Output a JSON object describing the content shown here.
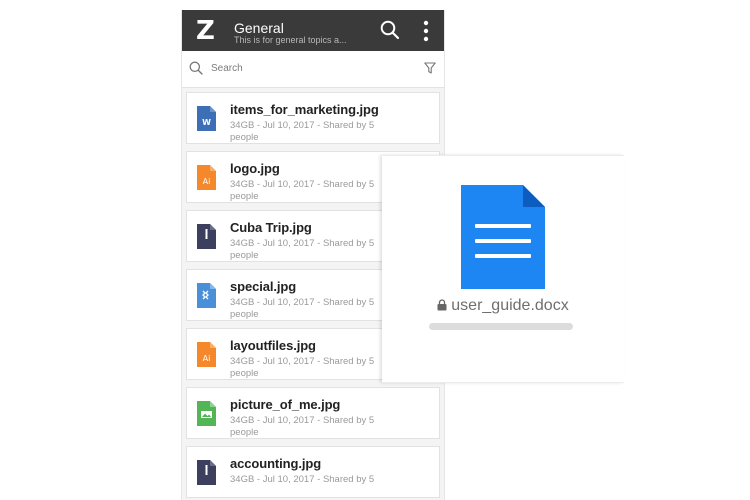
{
  "app": {
    "logo_letter": "Z",
    "title": "General",
    "subtitle": "This is for general topics a..."
  },
  "search": {
    "placeholder": "Search"
  },
  "files": [
    {
      "name": "items_for_marketing.jpg",
      "meta": "34GB -  Jul 10, 2017  - Shared by 5 people",
      "icon": "word-doc-icon",
      "color": "#3d6fb6",
      "glyph": "W"
    },
    {
      "name": "logo.jpg",
      "meta": "34GB -  Jul 10, 2017  - Shared by 5 people",
      "icon": "illustrator-file-icon",
      "color": "#f5882b",
      "glyph": "Ai"
    },
    {
      "name": "Cuba Trip.jpg",
      "meta": "34GB -  Jul 10, 2017  - Shared by 5 people",
      "icon": "dark-file-icon",
      "color": "#3d3f5e",
      "glyph": ""
    },
    {
      "name": "special.jpg",
      "meta": "34GB -  Jul 10, 2017  - Shared by 5 people",
      "icon": "zip-file-icon",
      "color": "#4a90d9",
      "glyph": ""
    },
    {
      "name": "layoutfiles.jpg",
      "meta": "34GB -  Jul 10, 2017  - Shared by 5 people",
      "icon": "illustrator-file-icon",
      "color": "#f5882b",
      "glyph": "Ai"
    },
    {
      "name": "picture_of_me.jpg",
      "meta": "34GB -  Jul 10, 2017  - Shared by 5 people",
      "icon": "image-file-icon",
      "color": "#52b556",
      "glyph": ""
    },
    {
      "name": "accounting.jpg",
      "meta": "34GB -  Jul 10, 2017  - Shared by 5",
      "icon": "dark-file-icon",
      "color": "#3d3f5e",
      "glyph": ""
    }
  ],
  "preview": {
    "filename": "user_guide.docx",
    "doc_color": "#1e86f2",
    "loading_progress": 0
  },
  "colors": {
    "appbar": "#3a3a3a",
    "background": "#f4f4f4"
  }
}
